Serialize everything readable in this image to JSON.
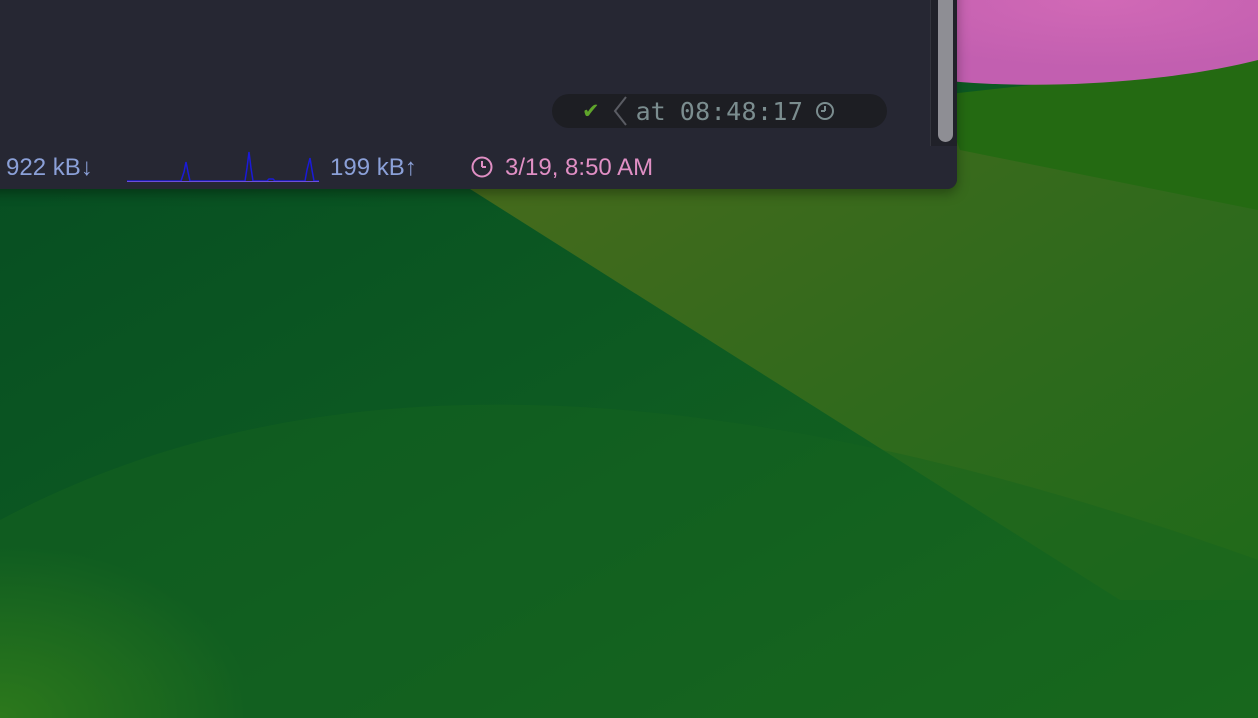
{
  "terminal": {
    "right_prompt": {
      "status_icon": "checkmark-icon",
      "at_label": "at",
      "time": "08:48:17",
      "clock_icon": "clock-icon"
    },
    "scrollbar": {
      "visible": true
    }
  },
  "statusbar": {
    "download_rate": "922 kB↓",
    "upload_rate": "199 kB↑",
    "datetime": "3/19, 8:50 AM",
    "datetime_icon": "clock-icon"
  },
  "colors": {
    "terminal_bg": "#262733",
    "prompt_pill_bg": "#1d1e23",
    "check_green": "#5fa52b",
    "prompt_text": "#7b8d8f",
    "net_text": "#8ba0d8",
    "graph_line": "#1515d8",
    "clock_pink": "#e08fc4"
  }
}
